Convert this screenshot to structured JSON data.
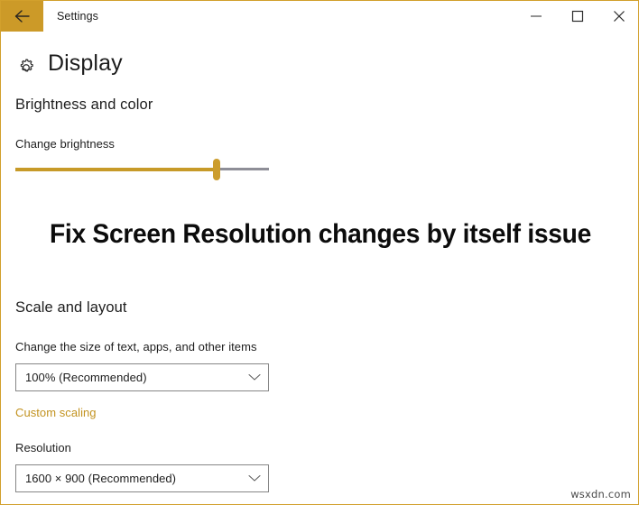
{
  "window": {
    "title": "Settings",
    "back_icon": "arrow-left-icon",
    "controls": {
      "minimize": "minimize-icon",
      "maximize": "maximize-icon",
      "close": "close-icon"
    },
    "accent_color": "#cc9a28",
    "border_color": "#d2a02c"
  },
  "page": {
    "icon": "gear-icon",
    "title": "Display"
  },
  "brightness": {
    "section_heading": "Brightness and color",
    "slider_label": "Change brightness",
    "slider_value_percent": 79,
    "fill_color": "#c79a28",
    "track_color": "#8e8e97"
  },
  "overlay": {
    "banner_text": "Fix Screen Resolution changes by itself issue"
  },
  "scale": {
    "section_heading": "Scale and layout",
    "size_label": "Change the size of text, apps, and other items",
    "size_value": "100% (Recommended)",
    "chevron_icon": "chevron-down-icon",
    "custom_scaling_link": "Custom scaling",
    "link_color": "#c2921f",
    "resolution_label": "Resolution",
    "resolution_value": "1600 × 900 (Recommended)"
  },
  "watermark": {
    "text": "wsxdn.com"
  }
}
